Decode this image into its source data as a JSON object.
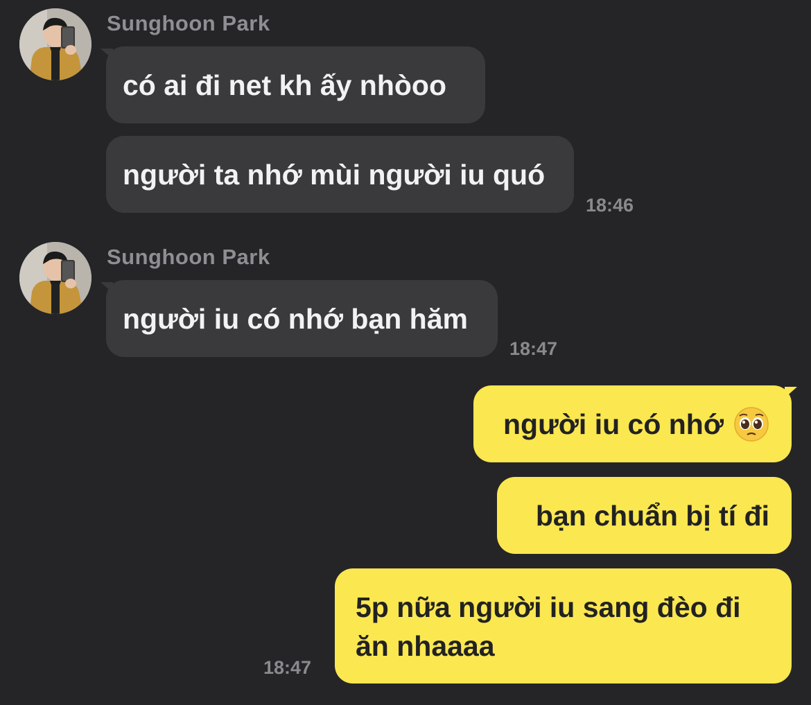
{
  "groups": [
    {
      "sender": "Sunghoon Park",
      "avatar_icon": "profile-photo-avatar",
      "messages": [
        "có ai đi net kh ấy nhòoo",
        "người ta nhớ mùi người iu quó"
      ],
      "time": "18:46"
    },
    {
      "sender": "Sunghoon Park",
      "avatar_icon": "profile-photo-avatar",
      "messages": [
        "người iu có nhớ bạn hăm"
      ],
      "time": "18:47"
    }
  ],
  "outgoing": {
    "messages": [
      "người iu có nhớ",
      "bạn chuẩn bị tí đi",
      "5p nữa người iu sang đèo đi ăn nhaaaa"
    ],
    "emoji": "pleading-face-emoji",
    "time": "18:47"
  },
  "colors": {
    "background": "#252528",
    "incoming_bubble": "#3a3a3c",
    "outgoing_bubble": "#fbe750",
    "timestamp": "#8a8a8e"
  }
}
